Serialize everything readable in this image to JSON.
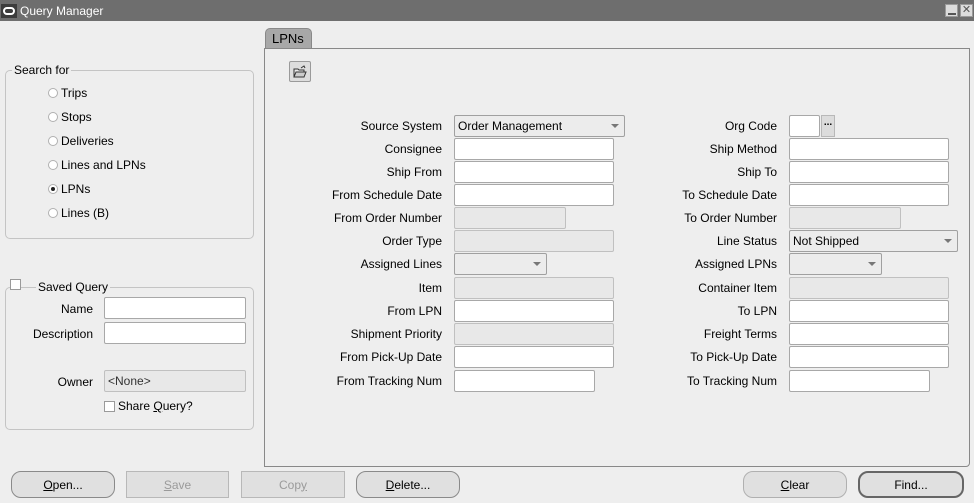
{
  "window": {
    "title": "Query Manager",
    "minimize_icon": "minimize-icon",
    "close_icon": "close-icon"
  },
  "search_for": {
    "legend": "Search for",
    "options": [
      {
        "label": "Trips",
        "selected": false
      },
      {
        "label": "Stops",
        "selected": false
      },
      {
        "label": "Deliveries",
        "selected": false
      },
      {
        "label": "Lines and LPNs",
        "selected": false
      },
      {
        "label": "LPNs",
        "selected": true
      },
      {
        "label": "Lines (B)",
        "selected": false
      }
    ]
  },
  "saved_query": {
    "legend": "Saved Query",
    "checked": false,
    "name_label": "Name",
    "name_value": "",
    "description_label": "Description",
    "description_value": "",
    "owner_label": "Owner",
    "owner_value": "<None>",
    "share_label": "Share Query?",
    "share_checked": false
  },
  "tab": {
    "label": "LPNs"
  },
  "toolbar": {
    "open_folder_icon": "open-folder-icon"
  },
  "form": {
    "left": [
      {
        "label": "Source System",
        "value": "Order Management",
        "type": "select"
      },
      {
        "label": "Consignee",
        "value": "",
        "type": "text"
      },
      {
        "label": "Ship From",
        "value": "",
        "type": "text"
      },
      {
        "label": "From Schedule Date",
        "value": "",
        "type": "text"
      },
      {
        "label": "From Order Number",
        "value": "",
        "type": "readonly"
      },
      {
        "label": "Order Type",
        "value": "",
        "type": "readonly"
      },
      {
        "label": "Assigned Lines",
        "value": "",
        "type": "select"
      },
      {
        "label": "Item",
        "value": "",
        "type": "readonly"
      },
      {
        "label": "From LPN",
        "value": "",
        "type": "text"
      },
      {
        "label": "Shipment Priority",
        "value": "",
        "type": "readonly"
      },
      {
        "label": "From Pick-Up Date",
        "value": "",
        "type": "text"
      },
      {
        "label": "From Tracking Num",
        "value": "",
        "type": "text"
      }
    ],
    "right": [
      {
        "label": "Org Code",
        "value": "",
        "type": "lov"
      },
      {
        "label": "Ship Method",
        "value": "",
        "type": "text"
      },
      {
        "label": "Ship To",
        "value": "",
        "type": "text"
      },
      {
        "label": "To Schedule Date",
        "value": "",
        "type": "text"
      },
      {
        "label": "To Order Number",
        "value": "",
        "type": "readonly"
      },
      {
        "label": "Line Status",
        "value": "Not Shipped",
        "type": "select"
      },
      {
        "label": "Assigned LPNs",
        "value": "",
        "type": "select"
      },
      {
        "label": "Container Item",
        "value": "",
        "type": "readonly"
      },
      {
        "label": "To LPN",
        "value": "",
        "type": "text"
      },
      {
        "label": "Freight Terms",
        "value": "",
        "type": "text"
      },
      {
        "label": "To Pick-Up Date",
        "value": "",
        "type": "text"
      },
      {
        "label": "To Tracking Num",
        "value": "",
        "type": "text"
      }
    ],
    "lov_button": "..."
  },
  "buttons": {
    "open": "Open...",
    "save": "Save",
    "copy": "Copy",
    "delete": "Delete...",
    "clear": "Clear",
    "find": "Find..."
  }
}
